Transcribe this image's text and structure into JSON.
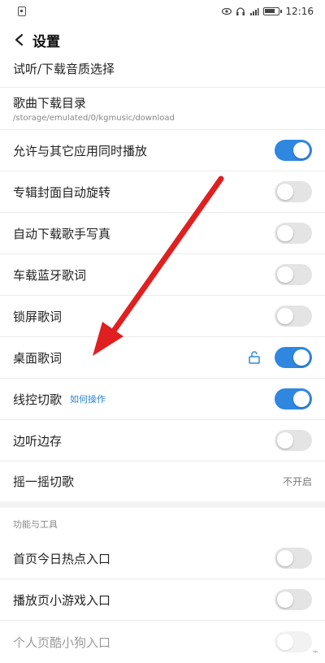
{
  "status_bar": {
    "time": "12:16"
  },
  "header": {
    "title": "设置"
  },
  "rows": [
    {
      "label": "试听/下载音质选择"
    },
    {
      "label": "歌曲下载目录",
      "sub": "/storage/emulated/0/kgmusic/download"
    },
    {
      "label": "允许与其它应用同时播放",
      "toggle": "on"
    },
    {
      "label": "专辑封面自动旋转",
      "toggle": "off"
    },
    {
      "label": "自动下载歌手写真",
      "toggle": "off"
    },
    {
      "label": "车载蓝牙歌词",
      "toggle": "off"
    },
    {
      "label": "锁屏歌词",
      "toggle": "off"
    },
    {
      "label": "桌面歌词",
      "toggle": "on"
    },
    {
      "label": "线控切歌",
      "link": "如何操作",
      "toggle": "on"
    },
    {
      "label": "边听边存",
      "toggle": "off"
    },
    {
      "label": "摇一摇切歌",
      "value": "不开启"
    }
  ],
  "section2": {
    "title": "功能与工具",
    "rows": [
      {
        "label": "首页今日热点入口",
        "toggle": "off"
      },
      {
        "label": "播放页小游戏入口",
        "toggle": "off"
      },
      {
        "label": "个人页酷小狗入口",
        "toggle": "off"
      }
    ]
  },
  "colors": {
    "accent": "#2f87e0",
    "annotation_arrow": "#e02020"
  },
  "icons": [
    "back-icon",
    "unlock-icon",
    "eye-icon",
    "headphone-icon",
    "battery-icon"
  ]
}
